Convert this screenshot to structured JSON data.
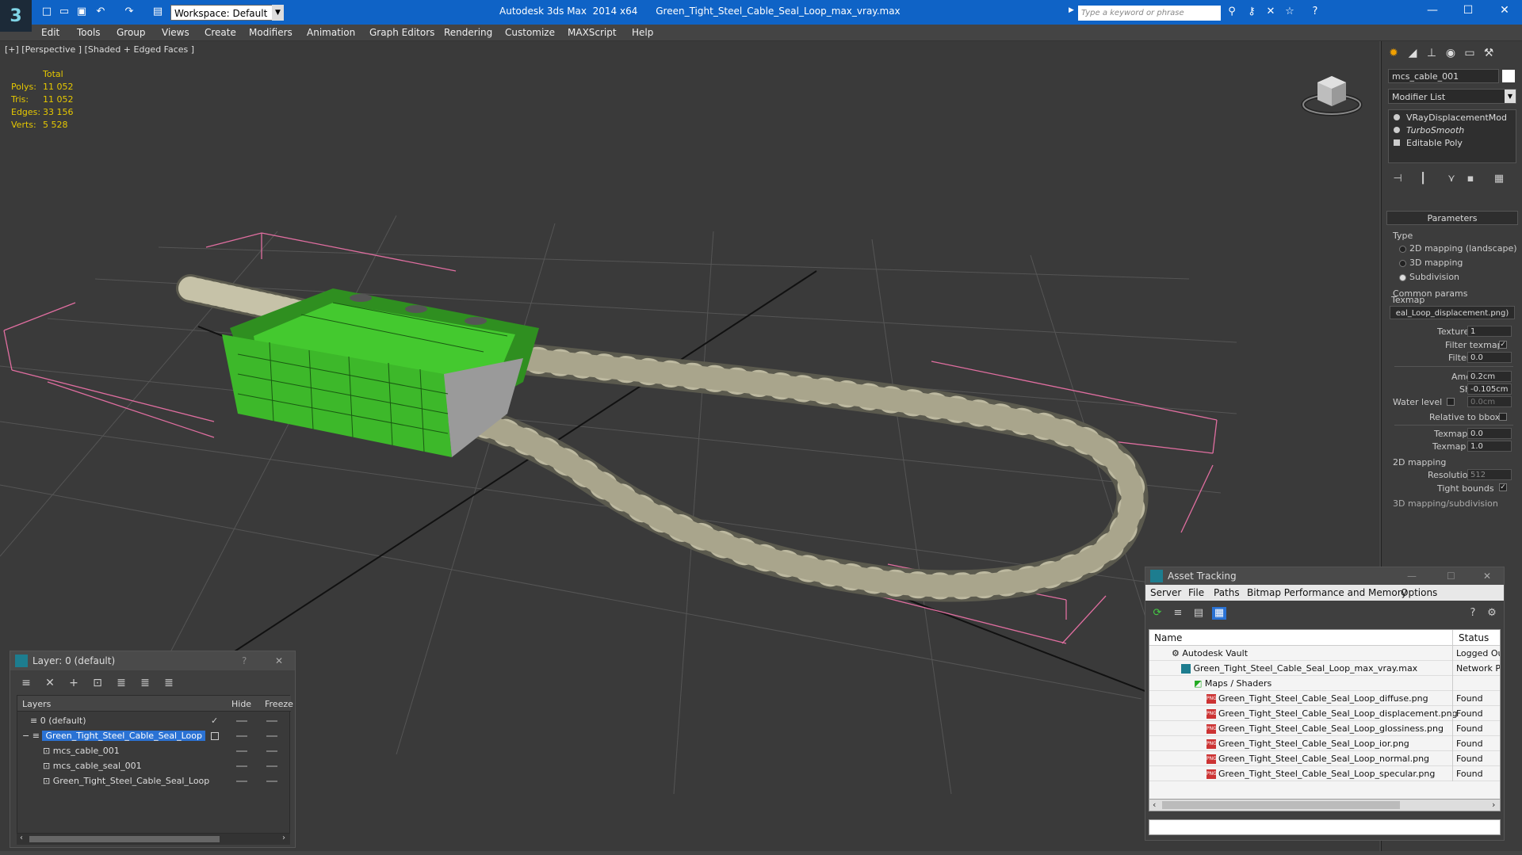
{
  "titlebar": {
    "app_title": "Autodesk 3ds Max  2014 x64",
    "file_title": "Green_Tight_Steel_Cable_Seal_Loop_max_vray.max",
    "workspace": "Workspace: Default",
    "search_placeholder": "Type a keyword or phrase"
  },
  "menu": [
    "Edit",
    "Tools",
    "Group",
    "Views",
    "Create",
    "Modifiers",
    "Animation",
    "Graph Editors",
    "Rendering",
    "Customize",
    "MAXScript",
    "Help"
  ],
  "viewport": {
    "label": "[+] [Perspective ] [Shaded + Edged Faces ]",
    "stats": {
      "header": "Total",
      "polys_label": "Polys:",
      "polys": "11 052",
      "tris_label": "Tris:",
      "tris": "11 052",
      "edges_label": "Edges:",
      "edges": "33 156",
      "verts_label": "Verts:",
      "verts": "5 528"
    }
  },
  "command_panel": {
    "object_name": "mcs_cable_001",
    "modifier_list": "Modifier List",
    "stack": [
      "VRayDisplacementMod",
      "TurboSmooth",
      "Editable Poly"
    ],
    "params_title": "Parameters",
    "type_label": "Type",
    "type_options": [
      "2D mapping (landscape)",
      "3D mapping",
      "Subdivision"
    ],
    "common_params": "Common params",
    "texmap_label": "Texmap",
    "texmap_value": "eal_Loop_displacement.png)",
    "texture_chan_label": "Texture chan",
    "texture_chan": "1",
    "filter_texmap_label": "Filter texmap",
    "filter_blur_label": "Filter blur",
    "filter_blur": "0.0",
    "amount_label": "Amount",
    "amount": "0.2cm",
    "shift_label": "Shift",
    "shift": "-0.105cm",
    "water_level_label": "Water level",
    "water_level": "0.0cm",
    "relative_bbox_label": "Relative to bbox",
    "texmap_min_label": "Texmap min",
    "texmap_min": "0.0",
    "texmap_max_label": "Texmap max",
    "texmap_max": "1.0",
    "mapping2d_label": "2D mapping",
    "resolution_label": "Resolution",
    "resolution": "512",
    "tight_bounds_label": "Tight bounds",
    "mapping3d_label": "3D mapping/subdivision"
  },
  "layer_window": {
    "title": "Layer: 0 (default)",
    "help": "?",
    "col_layers": "Layers",
    "col_hide": "Hide",
    "col_freeze": "Freeze",
    "rows": [
      "0 (default)",
      "Green_Tight_Steel_Cable_Seal_Loop",
      "mcs_cable_001",
      "mcs_cable_seal_001",
      "Green_Tight_Steel_Cable_Seal_Loop"
    ]
  },
  "asset_window": {
    "title": "Asset Tracking",
    "menu": [
      "Server",
      "File",
      "Paths",
      "Bitmap Performance and Memory",
      "Options"
    ],
    "col_name": "Name",
    "col_status": "Status",
    "rows": [
      {
        "name": "Autodesk Vault",
        "status": "Logged Ou"
      },
      {
        "name": "Green_Tight_Steel_Cable_Seal_Loop_max_vray.max",
        "status": "Network Pa"
      },
      {
        "name": "Maps / Shaders",
        "status": ""
      },
      {
        "name": "Green_Tight_Steel_Cable_Seal_Loop_diffuse.png",
        "status": "Found"
      },
      {
        "name": "Green_Tight_Steel_Cable_Seal_Loop_displacement.png",
        "status": "Found"
      },
      {
        "name": "Green_Tight_Steel_Cable_Seal_Loop_glossiness.png",
        "status": "Found"
      },
      {
        "name": "Green_Tight_Steel_Cable_Seal_Loop_ior.png",
        "status": "Found"
      },
      {
        "name": "Green_Tight_Steel_Cable_Seal_Loop_normal.png",
        "status": "Found"
      },
      {
        "name": "Green_Tight_Steel_Cable_Seal_Loop_specular.png",
        "status": "Found"
      }
    ]
  },
  "colors": {
    "title_bg": "#0f63c6",
    "seal_green": "#3fc32a",
    "cable": "#b8b49a",
    "stats_yellow": "#e6c800",
    "bbox": "#e06ea0"
  }
}
